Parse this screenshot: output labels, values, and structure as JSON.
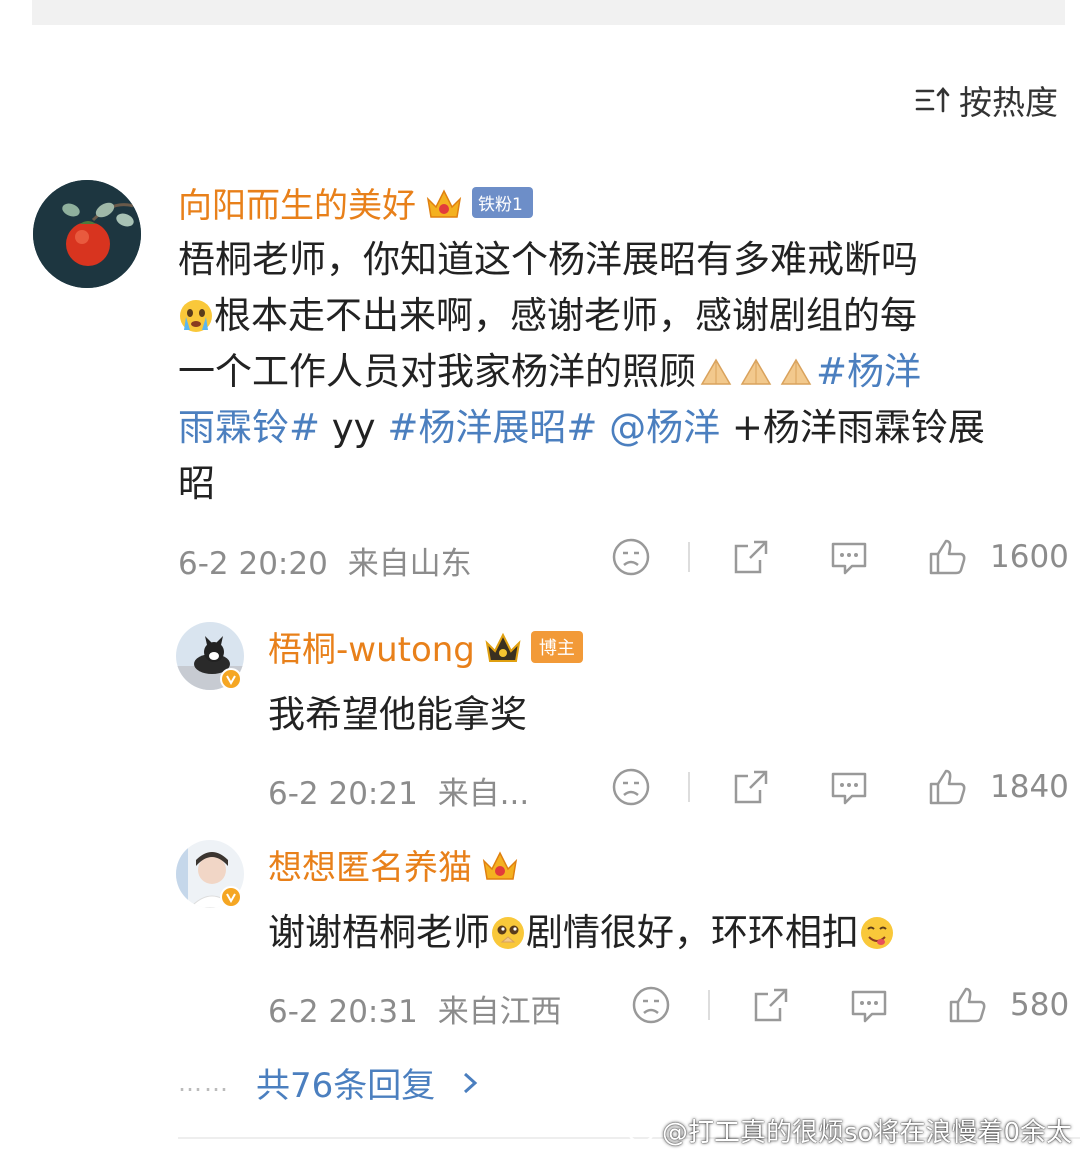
{
  "sort": {
    "label": "按热度",
    "icon": "sort-icon"
  },
  "comment": {
    "username": "向阳而生的美好",
    "fan_badge": "铁粉1",
    "text_1": "梧桐老师，你知道这个杨洋展昭有多难戒断吗",
    "text_2": "根本走不出来啊，感谢老师，感谢剧组的每",
    "text_3": "一个工作人员对我家杨洋的照顾",
    "tag_1": "#杨洋",
    "tag_1b": "雨霖铃#",
    "text_yy": " yy ",
    "tag_2": "#杨洋展昭#",
    "mention": "@杨洋",
    "text_4": " +杨洋雨霖铃展",
    "text_5": "昭",
    "time": "6-2 20:20",
    "location": "来自山东",
    "likes": "1600"
  },
  "replies": [
    {
      "username": "梧桐-wutong",
      "badge": "博主",
      "text": "我希望他能拿奖",
      "time": "6-2 20:21",
      "location": "来自...",
      "likes": "1840"
    },
    {
      "username": "想想匿名养猫",
      "text_a": "谢谢梧桐老师",
      "text_b": "剧情很好，环环相扣",
      "time": "6-2 20:31",
      "location": "来自江西",
      "likes": "580"
    }
  ],
  "more_replies": {
    "label": "共76条回复",
    "dots": "……"
  },
  "watermark": "@打工真的很烦so将在浪慢着0余太"
}
